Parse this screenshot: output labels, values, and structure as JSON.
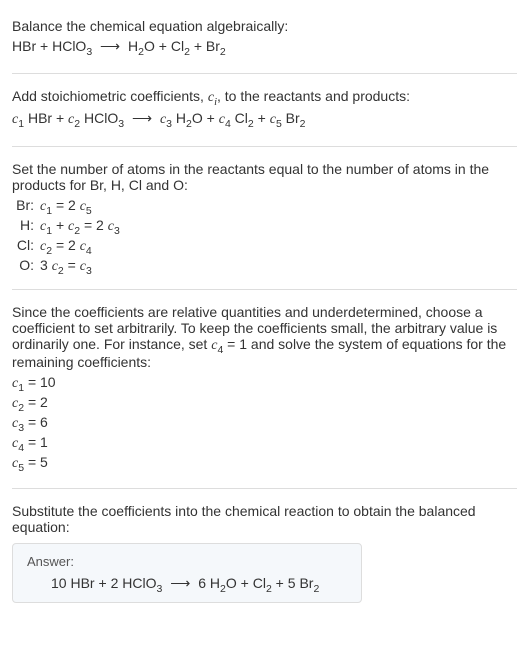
{
  "section1": {
    "title": "Balance the chemical equation algebraically:",
    "eq_parts": {
      "r1": "HBr",
      "plus1": " + ",
      "r2": "HClO",
      "r2sub": "3",
      "arrow": " ⟶ ",
      "p1": "H",
      "p1sub": "2",
      "p1b": "O",
      "plus2": " + ",
      "p2": "Cl",
      "p2sub": "2",
      "plus3": " + ",
      "p3": "Br",
      "p3sub": "2"
    }
  },
  "section2": {
    "title_a": "Add stoichiometric coefficients, ",
    "title_ci_c": "c",
    "title_ci_i": "i",
    "title_b": ", to the reactants and products:",
    "eq_parts": {
      "c1c": "c",
      "c1i": "1",
      "sp1": " ",
      "r1": "HBr",
      "plus1": " + ",
      "c2c": "c",
      "c2i": "2",
      "sp2": " ",
      "r2": "HClO",
      "r2sub": "3",
      "arrow": " ⟶ ",
      "c3c": "c",
      "c3i": "3",
      "sp3": " ",
      "p1": "H",
      "p1sub": "2",
      "p1b": "O",
      "plus2": " + ",
      "c4c": "c",
      "c4i": "4",
      "sp4": " ",
      "p2": "Cl",
      "p2sub": "2",
      "plus3": " + ",
      "c5c": "c",
      "c5i": "5",
      "sp5": " ",
      "p3": "Br",
      "p3sub": "2"
    }
  },
  "section3": {
    "title": "Set the number of atoms in the reactants equal to the number of atoms in the products for Br, H, Cl and O:",
    "rows": [
      {
        "lbl": "Br:",
        "c_a": "c",
        "i_a": "1",
        "mid": " = 2 ",
        "c_b": "c",
        "i_b": "5",
        "tail": ""
      },
      {
        "lbl": "H:",
        "c_a": "c",
        "i_a": "1",
        "mid": " + ",
        "c_b": "c",
        "i_b": "2",
        "tail_pre": " = 2 ",
        "c_c": "c",
        "i_c": "3"
      },
      {
        "lbl": "Cl:",
        "c_a": "c",
        "i_a": "2",
        "mid": " = 2 ",
        "c_b": "c",
        "i_b": "4",
        "tail": ""
      },
      {
        "lbl": "O:",
        "pre": "3 ",
        "c_a": "c",
        "i_a": "2",
        "mid": " = ",
        "c_b": "c",
        "i_b": "3",
        "tail": ""
      }
    ]
  },
  "section4": {
    "title_a": "Since the coefficients are relative quantities and underdetermined, choose a coefficient to set arbitrarily. To keep the coefficients small, the arbitrary value is ordinarily one. For instance, set ",
    "c4c": "c",
    "c4i": "4",
    "title_b": " = 1 and solve the system of equations for the remaining coefficients:",
    "coeffs": [
      {
        "c": "c",
        "i": "1",
        "eq": " = 10"
      },
      {
        "c": "c",
        "i": "2",
        "eq": " = 2"
      },
      {
        "c": "c",
        "i": "3",
        "eq": " = 6"
      },
      {
        "c": "c",
        "i": "4",
        "eq": " = 1"
      },
      {
        "c": "c",
        "i": "5",
        "eq": " = 5"
      }
    ]
  },
  "section5": {
    "title": "Substitute the coefficients into the chemical reaction to obtain the balanced equation:",
    "answer_label": "Answer:",
    "eq_parts": {
      "n1": "10 ",
      "r1": "HBr",
      "plus1": " + ",
      "n2": "2 ",
      "r2": "HClO",
      "r2sub": "3",
      "arrow": " ⟶ ",
      "n3": "6 ",
      "p1": "H",
      "p1sub": "2",
      "p1b": "O",
      "plus2": " + ",
      "p2": "Cl",
      "p2sub": "2",
      "plus3": " + ",
      "n5": "5 ",
      "p3": "Br",
      "p3sub": "2"
    }
  }
}
